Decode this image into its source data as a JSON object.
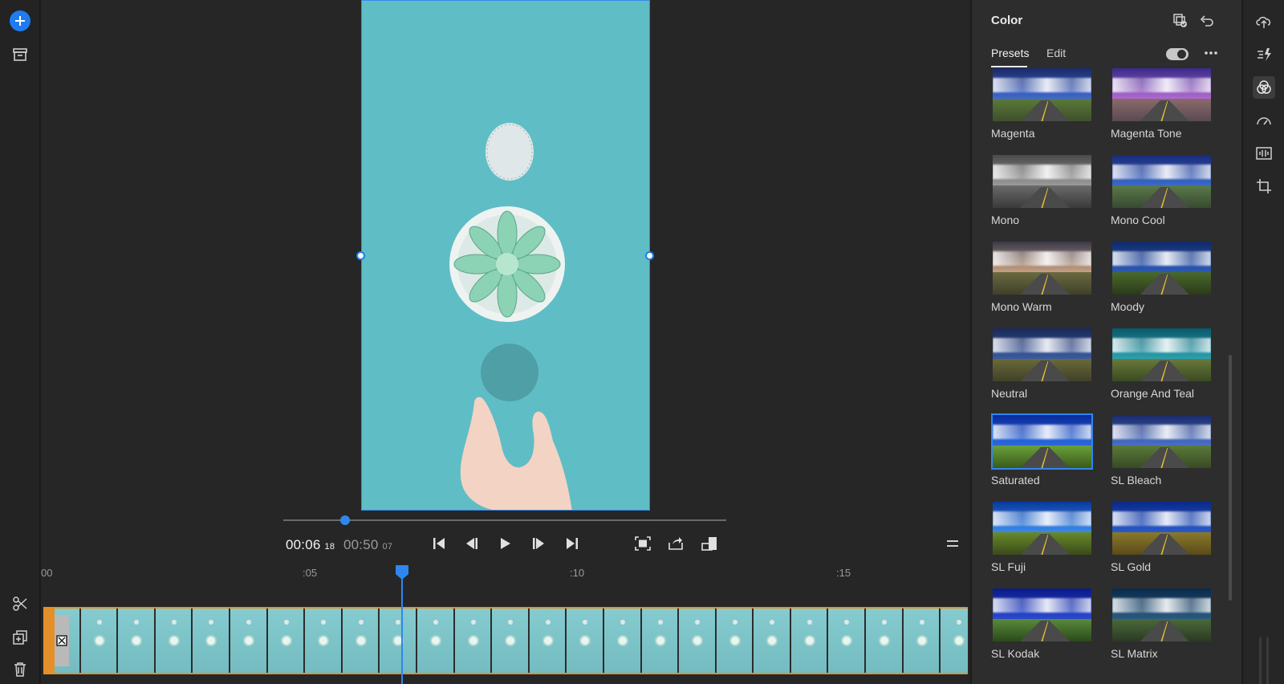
{
  "panel": {
    "title": "Color",
    "tabs": [
      {
        "label": "Presets",
        "active": true
      },
      {
        "label": "Edit",
        "active": false
      }
    ],
    "presets": [
      {
        "label": "Magenta",
        "tone": "magenta"
      },
      {
        "label": "Magenta Tone",
        "tone": "magentatone"
      },
      {
        "label": "Mono",
        "tone": "mono"
      },
      {
        "label": "Mono Cool",
        "tone": "monocool"
      },
      {
        "label": "Mono Warm",
        "tone": "monowarm"
      },
      {
        "label": "Moody",
        "tone": "moody"
      },
      {
        "label": "Neutral",
        "tone": "neutral"
      },
      {
        "label": "Orange And Teal",
        "tone": "orangeteal"
      },
      {
        "label": "Saturated",
        "tone": "saturated",
        "selected": true
      },
      {
        "label": "SL Bleach",
        "tone": "bleach"
      },
      {
        "label": "SL Fuji",
        "tone": "fuji"
      },
      {
        "label": "SL Gold",
        "tone": "gold"
      },
      {
        "label": "SL Kodak",
        "tone": "kodak"
      },
      {
        "label": "SL Matrix",
        "tone": "matrix"
      }
    ]
  },
  "transport": {
    "current_time": "00:06",
    "current_frames": "18",
    "duration": "00:50",
    "duration_frames": "07",
    "scrub_progress": 0.13
  },
  "ruler": {
    "labels": [
      "00",
      ":05",
      ":10",
      ":15"
    ]
  },
  "colors": {
    "accent": "#2f86f0",
    "clip_border": "#e3902a",
    "video_bg": "#5fbdc6"
  },
  "icons": {
    "left_rail": [
      "plus-icon",
      "archive-icon",
      "scissors-icon",
      "duplicate-icon",
      "trash-icon"
    ],
    "right_rail": [
      "upload-cloud-icon",
      "speed-icon",
      "color-wheels-icon",
      "gauge-icon",
      "audio-icon",
      "crop-icon"
    ]
  }
}
